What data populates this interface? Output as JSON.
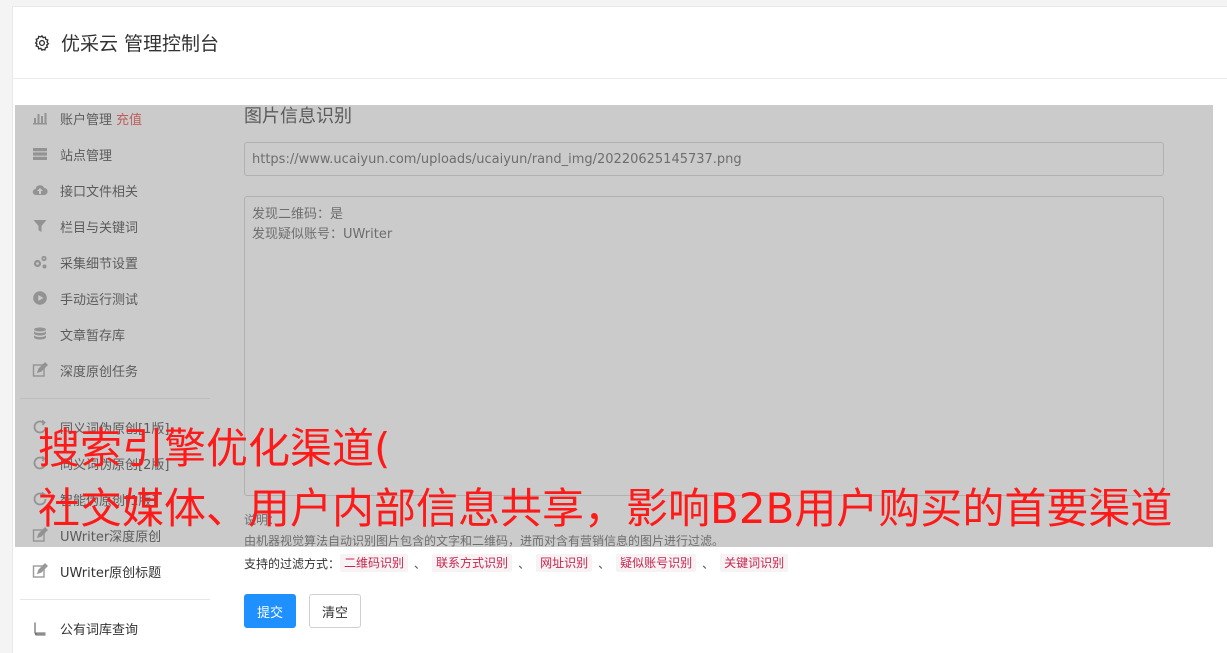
{
  "header": {
    "title": "优采云 管理控制台"
  },
  "sidebar": {
    "items": [
      {
        "label": "账户管理",
        "badge": "充值",
        "icon": "bar-chart-icon"
      },
      {
        "label": "站点管理",
        "icon": "server-icon"
      },
      {
        "label": "接口文件相关",
        "icon": "cloud-upload-icon"
      },
      {
        "label": "栏目与关键词",
        "icon": "filter-icon"
      },
      {
        "label": "采集细节设置",
        "icon": "gears-icon"
      },
      {
        "label": "手动运行测试",
        "icon": "play-circle-icon"
      },
      {
        "label": "文章暂存库",
        "icon": "database-icon"
      },
      {
        "label": "深度原创任务",
        "icon": "edit-icon"
      },
      {
        "label": "同义词伪原创[1版]",
        "icon": "refresh-icon"
      },
      {
        "label": "同义词伪原创[2版]",
        "icon": "refresh-icon"
      },
      {
        "label": "智能伪原创[1版]",
        "icon": "refresh-icon"
      },
      {
        "label": "UWriter深度原创",
        "icon": "edit-icon"
      },
      {
        "label": "UWriter原创标题",
        "icon": "edit-icon"
      },
      {
        "label": "公有词库查询",
        "icon": "book-icon"
      }
    ]
  },
  "main": {
    "title": "图片信息识别",
    "url_value": "https://www.ucaiyun.com/uploads/ucaiyun/rand_img/20220625145737.png",
    "result_lines": [
      "发现二维码：是",
      "发现疑似账号：UWriter"
    ],
    "desc_label": "说明：",
    "desc_text": "由机器视觉算法自动识别图片包含的文字和二维码，进而对含有营销信息的图片进行过滤。",
    "filters_label": "支持的过滤方式：",
    "filters": [
      "二维码识别",
      "联系方式识别",
      "网址识别",
      "疑似账号识别",
      "关键词识别"
    ],
    "filter_sep": "、",
    "submit_label": "提交",
    "clear_label": "清空"
  },
  "overlay": {
    "line1": "搜索引擎优化渠道(",
    "line2": "社交媒体、用户内部信息共享，影响B2B用户购买的首要渠道"
  }
}
